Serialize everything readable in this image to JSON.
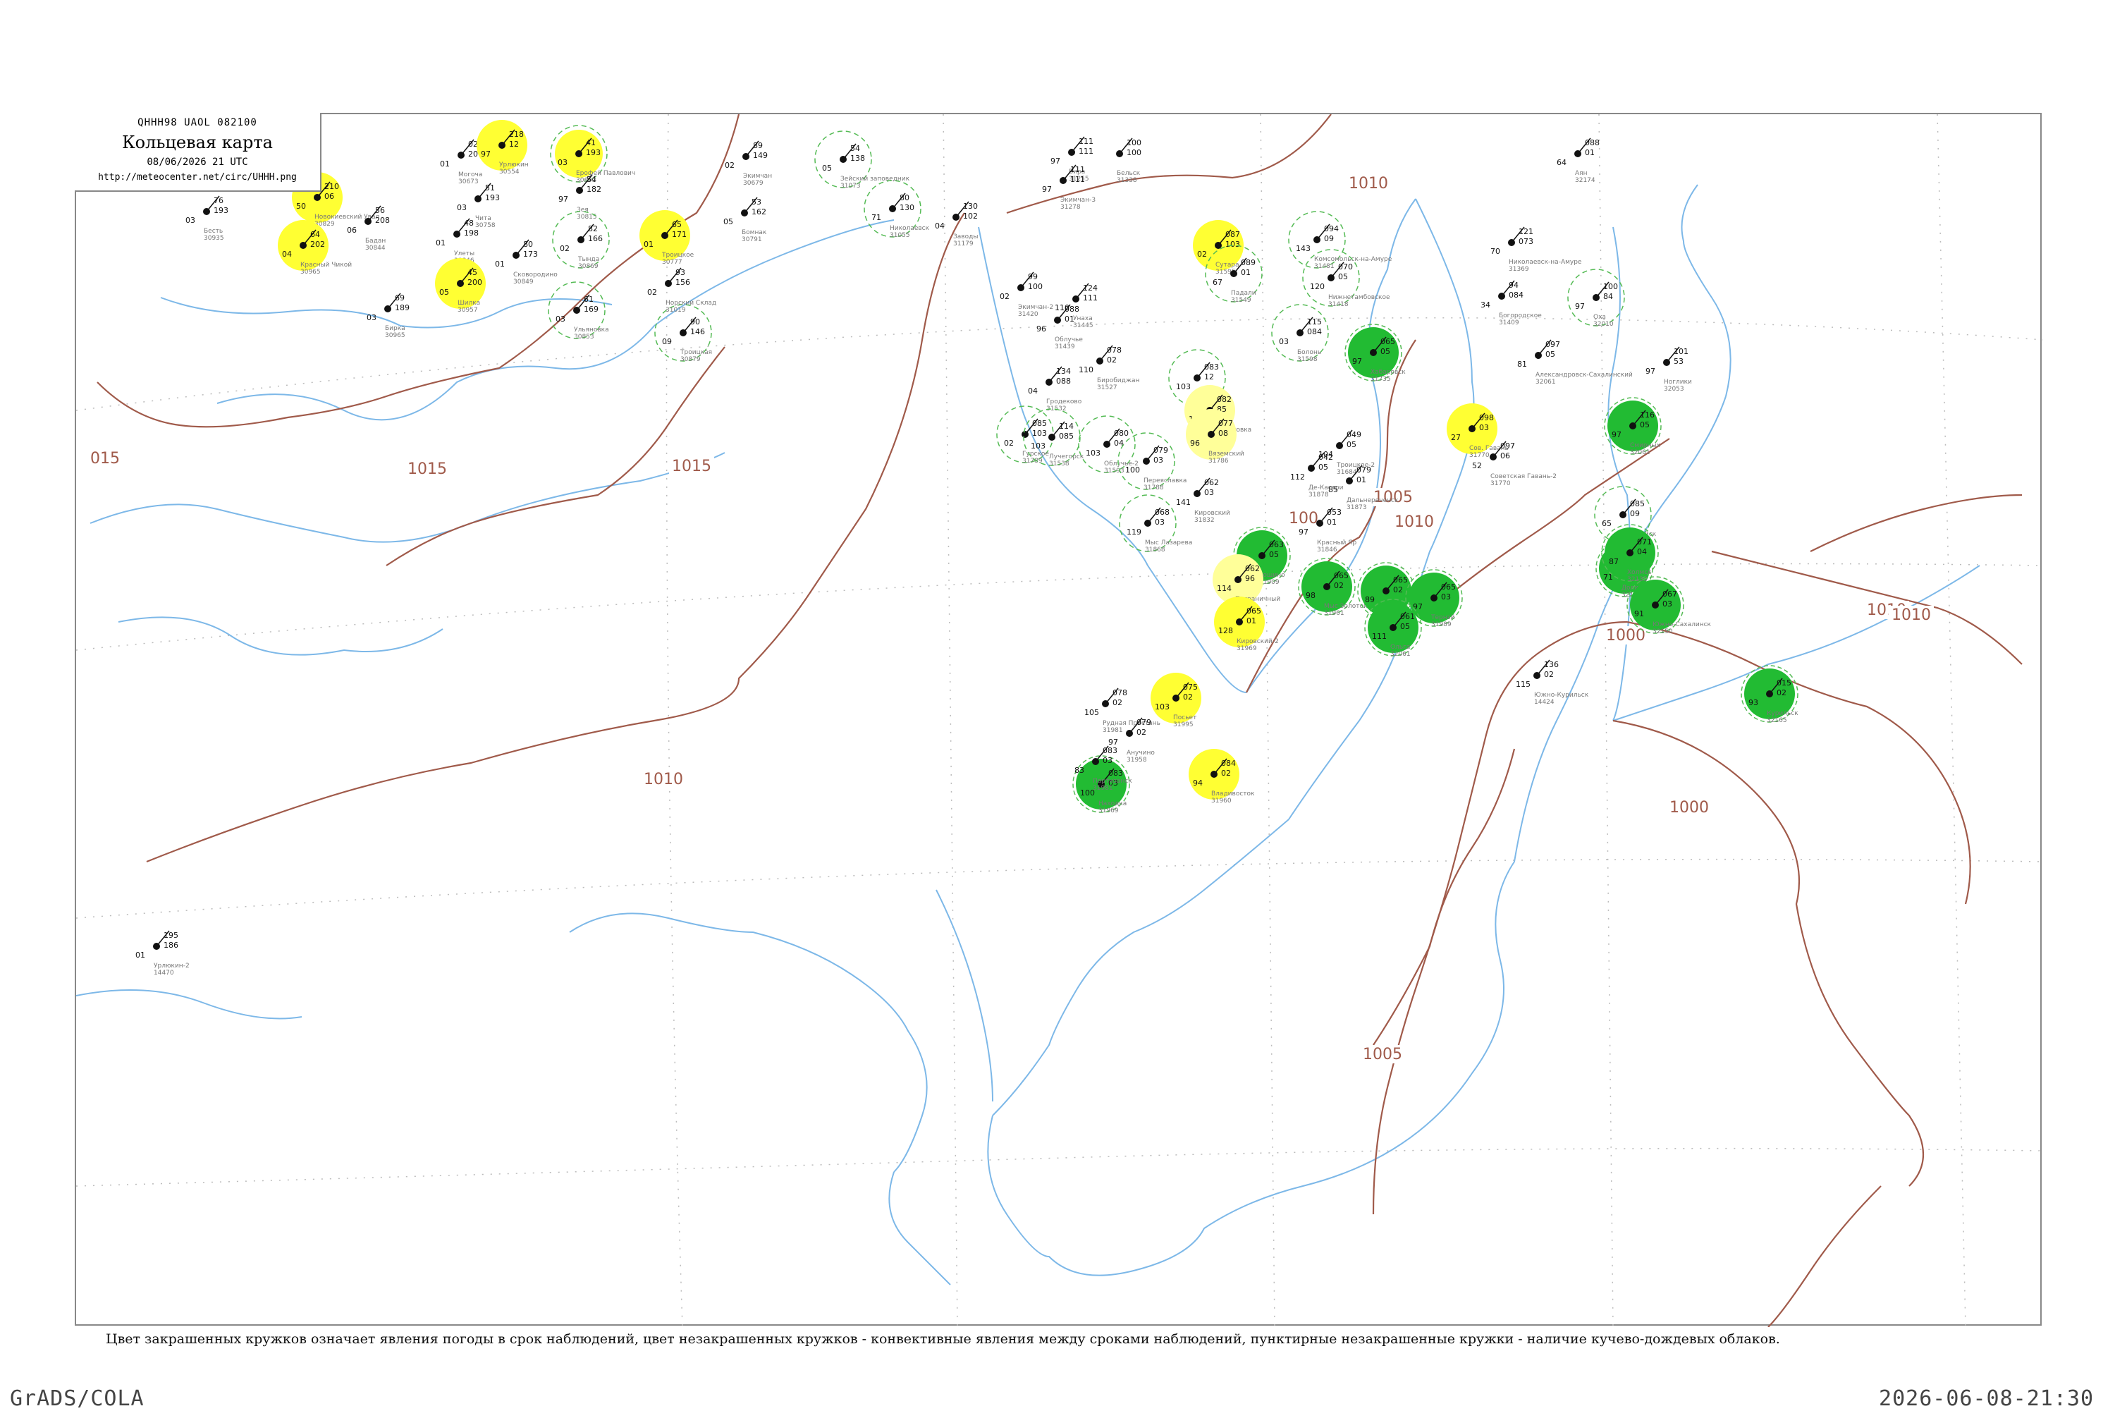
{
  "header": {
    "code": "QHHH98  UAOL  082100",
    "title": "Кольцевая карта",
    "date": "08/06/2026 21 UTC",
    "url": "http://meteocenter.net/circ/UHHH.png"
  },
  "legend_note": "Цвет закрашенных кружков означает явления погоды в срок наблюдений, цвет незакрашенных кружков - конвективные явления между сроками наблюдений, пунктирные незакрашенные кружки - наличие кучево-дождевых облаков.",
  "footer": {
    "left": "GrADS/COLA",
    "right": "2026-06-08-21:30"
  },
  "colors": {
    "isobar": "#a05a4a",
    "coast": "#7db8e8",
    "yellow_fill": "#ffff33",
    "yellow_light": "#ffff99",
    "green_fill": "#22bb33",
    "green_ring": "#55bb55"
  },
  "isobars": [
    {
      "label": "1015"
    },
    {
      "label": "1015"
    },
    {
      "label": "1010"
    },
    {
      "label": "1010"
    },
    {
      "label": "1010"
    },
    {
      "label": "1010"
    },
    {
      "label": "1005"
    },
    {
      "label": "1005"
    },
    {
      "label": "1000"
    },
    {
      "label": "1000"
    },
    {
      "label": "1010"
    },
    {
      "label": "015"
    },
    {
      "label": "100"
    }
  ],
  "stations": [
    {
      "name": "Новокиевский Увал",
      "id": "30829",
      "vals": [
        "210",
        "06",
        "50"
      ],
      "mark": "yellow"
    },
    {
      "name": "Бесть",
      "id": "30935",
      "vals": [
        "76",
        "193",
        "03"
      ],
      "mark": "none"
    },
    {
      "name": "Красный Чикой",
      "id": "30965",
      "vals": [
        "64",
        "202",
        "04"
      ],
      "mark": "yellow"
    },
    {
      "name": "Бадан",
      "id": "30844",
      "vals": [
        "56",
        "208",
        "06"
      ],
      "mark": "none"
    },
    {
      "name": "Могоча",
      "id": "30673",
      "vals": [
        "02",
        "207",
        "01"
      ],
      "mark": "none"
    },
    {
      "name": "Чита",
      "id": "30758",
      "vals": [
        "51",
        "193",
        "03"
      ],
      "mark": "none"
    },
    {
      "name": "Урлюкин",
      "id": "30554",
      "vals": [
        "218",
        "12",
        "97"
      ],
      "mark": "yellow"
    },
    {
      "name": "Улеты",
      "id": "30846",
      "vals": [
        "48",
        "198",
        "01"
      ],
      "mark": "none"
    },
    {
      "name": "Ерофей Павлович",
      "id": "30692",
      "vals": [
        "41",
        "193",
        "03"
      ],
      "mark": "yellow_ring"
    },
    {
      "name": "Зея",
      "id": "30815",
      "vals": [
        "54",
        "182",
        "97"
      ],
      "mark": "none"
    },
    {
      "name": "Сковородино",
      "id": "30849",
      "vals": [
        "80",
        "173",
        "01"
      ],
      "mark": "none"
    },
    {
      "name": "Бирка",
      "id": "30965",
      "vals": [
        "69",
        "189",
        "03"
      ],
      "mark": "none"
    },
    {
      "name": "Шилка",
      "id": "30957",
      "vals": [
        "45",
        "200",
        "05"
      ],
      "mark": "yellow"
    },
    {
      "name": "Тында",
      "id": "30869",
      "vals": [
        "82",
        "166",
        "02"
      ],
      "mark": "green_ring"
    },
    {
      "name": "Троицкое",
      "id": "30777",
      "vals": [
        "65",
        "171",
        "01"
      ],
      "mark": "yellow"
    },
    {
      "name": "Ульяновка",
      "id": "30853",
      "vals": [
        "61",
        "169",
        "03"
      ],
      "mark": "green_ring"
    },
    {
      "name": "Троицкая",
      "id": "30879",
      "vals": [
        "90",
        "146",
        "09"
      ],
      "mark": "green_ring"
    },
    {
      "name": "Норский Склад",
      "id": "31019",
      "vals": [
        "93",
        "156",
        "02"
      ],
      "mark": "none"
    },
    {
      "name": "Экимчан",
      "id": "30679",
      "vals": [
        "89",
        "149",
        "02"
      ],
      "mark": "none"
    },
    {
      "name": "Бомнак",
      "id": "30791",
      "vals": [
        "53",
        "162",
        "05"
      ],
      "mark": "none"
    },
    {
      "name": "Зейский заповедник",
      "id": "31073",
      "vals": [
        "54",
        "138",
        "05"
      ],
      "mark": "green_ring"
    },
    {
      "name": "Николаевск",
      "id": "31055",
      "vals": [
        "80",
        "130",
        "71"
      ],
      "mark": "green_ring"
    },
    {
      "name": "Заводы",
      "id": "31179",
      "vals": [
        "130",
        "102",
        "04"
      ],
      "mark": "none"
    },
    {
      "name": "Бира",
      "id": "31255",
      "vals": [
        "111",
        "111",
        "97"
      ],
      "mark": "none"
    },
    {
      "name": "Бельск",
      "id": "31338",
      "vals": [
        "100",
        "100"
      ],
      "mark": "none"
    },
    {
      "name": "Экимчан-2",
      "id": "31420",
      "vals": [
        "99",
        "100",
        "02"
      ],
      "mark": "none"
    },
    {
      "name": "Облучье",
      "id": "31439",
      "vals": [
        "088",
        "01",
        "96"
      ],
      "mark": "none"
    },
    {
      "name": "Биробиджан",
      "id": "31527",
      "vals": [
        "078",
        "02",
        "110"
      ],
      "mark": "none"
    },
    {
      "name": "Сутара",
      "id": "31595",
      "vals": [
        "087",
        "103",
        "02"
      ],
      "mark": "yellow"
    },
    {
      "name": "Падали",
      "id": "31549",
      "vals": [
        "089",
        "01",
        "67"
      ],
      "mark": "green_ring"
    },
    {
      "name": "Комсомольск-на-Амуре",
      "id": "31481",
      "vals": [
        "094",
        "09",
        "143"
      ],
      "mark": "green_ring"
    },
    {
      "name": "Нижнетамбовское",
      "id": "31418",
      "vals": [
        "070",
        "05",
        "120"
      ],
      "mark": "green_ring"
    },
    {
      "name": "Болонь",
      "id": "31598",
      "vals": [
        "115",
        "084",
        "03"
      ],
      "mark": "green_ring"
    },
    {
      "name": "Хабаровск",
      "id": "31735",
      "vals": [
        "065",
        "05",
        "97"
      ],
      "mark": "green"
    },
    {
      "name": "Бикин",
      "id": "31696",
      "vals": [
        "083",
        "12",
        "103"
      ],
      "mark": "green_ring"
    },
    {
      "name": "Лермонтовка",
      "id": "31801",
      "vals": [
        "082",
        "85",
        "118"
      ],
      "mark": "yellow_light"
    },
    {
      "name": "Вяземский",
      "id": "31786",
      "vals": [
        "077",
        "08",
        "96"
      ],
      "mark": "yellow_light"
    },
    {
      "name": "Гурское",
      "id": "31789",
      "vals": [
        "085",
        "103",
        "02"
      ],
      "mark": "green_ring"
    },
    {
      "name": "Облучье-2",
      "id": "31593",
      "vals": [
        "080",
        "04",
        "103"
      ],
      "mark": "green_ring"
    },
    {
      "name": "Переяславка",
      "id": "31788",
      "vals": [
        "079",
        "03",
        "100"
      ],
      "mark": "green_ring"
    },
    {
      "name": "Кировский",
      "id": "31832",
      "vals": [
        "062",
        "03",
        "141"
      ],
      "mark": "none"
    },
    {
      "name": "Троицкое-2",
      "id": "31684",
      "vals": [
        "049",
        "05",
        "104"
      ],
      "mark": "none"
    },
    {
      "name": "Де-Кастри",
      "id": "31878",
      "vals": [
        "042",
        "05",
        "112"
      ],
      "mark": "none"
    },
    {
      "name": "Дальнереченск",
      "id": "31873",
      "vals": [
        "079",
        "01",
        "85"
      ],
      "mark": "none"
    },
    {
      "name": "Красный Яр",
      "id": "31846",
      "vals": [
        "053",
        "01",
        "97"
      ],
      "mark": "none"
    },
    {
      "name": "Мыс Лазарева",
      "id": "31868",
      "vals": [
        "068",
        "03",
        "119"
      ],
      "mark": "green_ring"
    },
    {
      "name": "Рощино",
      "id": "31909",
      "vals": [
        "063",
        "05",
        "113"
      ],
      "mark": "green"
    },
    {
      "name": "Мыс Золотой",
      "id": "31961",
      "vals": [
        "065",
        "02",
        "98"
      ],
      "mark": "green"
    },
    {
      "name": "Пограничный",
      "id": "31939",
      "vals": [
        "062",
        "96",
        "114"
      ],
      "mark": "yellow_light"
    },
    {
      "name": "Кировский-2",
      "id": "31969",
      "vals": [
        "065",
        "01",
        "128"
      ],
      "mark": "yellow"
    },
    {
      "name": "Преображение",
      "id": "31866",
      "vals": [
        "065",
        "02",
        "89"
      ],
      "mark": "green"
    },
    {
      "name": "Тернэй",
      "id": "31989",
      "vals": [
        "065",
        "03",
        "97"
      ],
      "mark": "green"
    },
    {
      "name": "Ольга",
      "id": "32061",
      "vals": [
        "061",
        "05",
        "111"
      ],
      "mark": "green"
    },
    {
      "name": "Посьет",
      "id": "31995",
      "vals": [
        "075",
        "02",
        "103"
      ],
      "mark": "yellow"
    },
    {
      "name": "Рудная Пристань",
      "id": "31981",
      "vals": [
        "078",
        "02",
        "105"
      ],
      "mark": "none"
    },
    {
      "name": "Анучино",
      "id": "31958",
      "vals": [
        "079",
        "02",
        "97"
      ],
      "mark": "none"
    },
    {
      "name": "Владивосток",
      "id": "31960",
      "vals": [
        "084",
        "02",
        "94"
      ],
      "mark": "yellow"
    },
    {
      "name": "Находка",
      "id": "31969",
      "vals": [
        "083",
        "03",
        "100"
      ],
      "mark": "green"
    },
    {
      "name": "Партизанск",
      "id": "31981",
      "vals": [
        "083",
        "03",
        "83"
      ],
      "mark": "none"
    },
    {
      "name": "Сов. Гавань",
      "id": "31770",
      "vals": [
        "098",
        "03",
        "27"
      ],
      "mark": "yellow"
    },
    {
      "name": "Советская Гавань-2",
      "id": "31770",
      "vals": [
        "097",
        "06",
        "52"
      ],
      "mark": "none"
    },
    {
      "name": "Николаевск-на-Амуре",
      "id": "31369",
      "vals": [
        "121",
        "073",
        "70"
      ],
      "mark": "none"
    },
    {
      "name": "Богородское",
      "id": "31409",
      "vals": [
        "94",
        "084",
        "34"
      ],
      "mark": "none"
    },
    {
      "name": "Александровск-Сахалинский",
      "id": "32061",
      "vals": [
        "097",
        "05",
        "81"
      ],
      "mark": "none"
    },
    {
      "name": "Ноглики",
      "id": "32053",
      "vals": [
        "101",
        "53",
        "97"
      ],
      "mark": "none"
    },
    {
      "name": "Оха",
      "id": "32010",
      "vals": [
        "100",
        "84",
        "97"
      ],
      "mark": "green_ring"
    },
    {
      "name": "Смирных",
      "id": "32061",
      "vals": [
        "116",
        "05",
        "97"
      ],
      "mark": "green"
    },
    {
      "name": "Поронайск",
      "id": "32098",
      "vals": [
        "085",
        "09",
        "65"
      ],
      "mark": "green_ring"
    },
    {
      "name": "Долинск",
      "id": "32128",
      "vals": [
        "086",
        "07",
        "71"
      ],
      "mark": "green"
    },
    {
      "name": "Холмск",
      "id": "32133",
      "vals": [
        "071",
        "04",
        "87"
      ],
      "mark": "green"
    },
    {
      "name": "Южно-Сахалинск",
      "id": "32150",
      "vals": [
        "067",
        "03",
        "91"
      ],
      "mark": "green"
    },
    {
      "name": "Аян",
      "id": "32174",
      "vals": [
        "088",
        "01",
        "64"
      ],
      "mark": "none"
    },
    {
      "name": "Курильск",
      "id": "32165",
      "vals": [
        "015",
        "02",
        "93"
      ],
      "mark": "green"
    },
    {
      "name": "Урлюкин-2",
      "id": "14470",
      "vals": [
        "195",
        "186",
        "01"
      ],
      "mark": "none"
    },
    {
      "name": "Южно-Курильск",
      "id": "14424",
      "vals": [
        "136",
        "02",
        "115"
      ],
      "mark": "none"
    },
    {
      "name": "Экимчан-3",
      "id": "31278",
      "vals": [
        "111",
        "111",
        "97"
      ],
      "mark": "none"
    },
    {
      "name": "Унаха",
      "id": "31445",
      "vals": [
        "124",
        "111",
        "110"
      ],
      "mark": "none"
    },
    {
      "name": "Гродеково",
      "id": "31532",
      "vals": [
        "134",
        "088",
        "04"
      ],
      "mark": "none"
    },
    {
      "name": "Лучегорск",
      "id": "31538",
      "vals": [
        "114",
        "085",
        "103"
      ],
      "mark": "green_ring"
    }
  ]
}
